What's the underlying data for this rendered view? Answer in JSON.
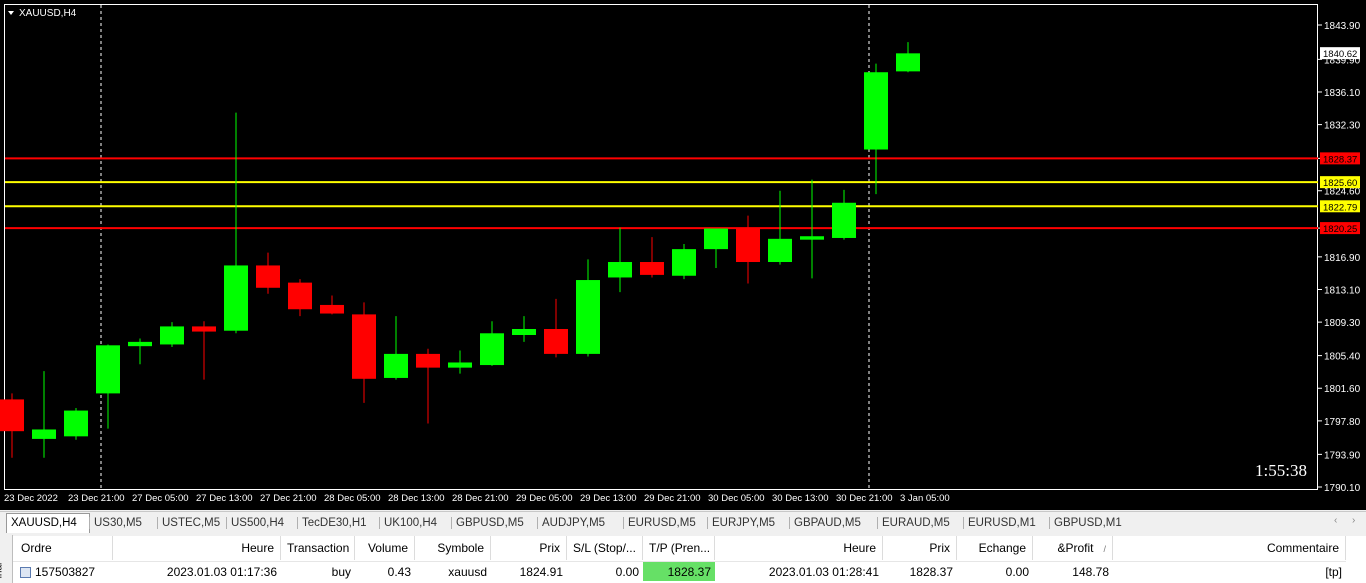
{
  "chart": {
    "symbol_label": "XAUUSD,H4",
    "countdown": "1:55:38",
    "price_axis": [
      "1843.90",
      "1839.90",
      "1836.10",
      "1832.30",
      "1828.37",
      "1824.60",
      "1820.25",
      "1816.90",
      "1813.10",
      "1809.30",
      "1805.40",
      "1801.60",
      "1797.80",
      "1793.90",
      "1790.10"
    ],
    "time_axis": [
      "23 Dec 2022",
      "23 Dec 21:00",
      "27 Dec 05:00",
      "27 Dec 13:00",
      "27 Dec 21:00",
      "28 Dec 05:00",
      "28 Dec 13:00",
      "28 Dec 21:00",
      "29 Dec 05:00",
      "29 Dec 13:00",
      "29 Dec 21:00",
      "30 Dec 05:00",
      "30 Dec 13:00",
      "30 Dec 21:00",
      "3 Jan 05:00"
    ],
    "current_price": "1840.62",
    "levels": [
      {
        "label": "1828.37",
        "price": 1828.37,
        "color": "#ff0000",
        "text_color": "#000000"
      },
      {
        "label": "1825.60",
        "price": 1825.6,
        "color": "#ffff00",
        "text_color": "#000000"
      },
      {
        "label": "1822.79",
        "price": 1822.79,
        "color": "#ffff00",
        "text_color": "#000000"
      },
      {
        "label": "1820.25",
        "price": 1820.25,
        "color": "#ff0000",
        "text_color": "#000000"
      }
    ],
    "colors": {
      "bull": "#00ff00",
      "bear": "#ff0000",
      "background": "#000000",
      "axis_text": "#ffffff"
    }
  },
  "chart_data": {
    "type": "candlestick",
    "title": "XAUUSD,H4",
    "ylim": [
      1790.1,
      1843.9
    ],
    "candles": [
      {
        "o": 1800.3,
        "h": 1801.0,
        "l": 1793.5,
        "c": 1796.6
      },
      {
        "o": 1795.7,
        "h": 1803.6,
        "l": 1793.5,
        "c": 1796.8
      },
      {
        "o": 1796.0,
        "h": 1799.3,
        "l": 1795.6,
        "c": 1799.0
      },
      {
        "o": 1801.0,
        "h": 1806.7,
        "l": 1796.9,
        "c": 1806.6
      },
      {
        "o": 1806.5,
        "h": 1807.4,
        "l": 1804.4,
        "c": 1807.0
      },
      {
        "o": 1806.7,
        "h": 1809.3,
        "l": 1806.4,
        "c": 1808.8
      },
      {
        "o": 1808.8,
        "h": 1809.4,
        "l": 1802.6,
        "c": 1808.2
      },
      {
        "o": 1808.3,
        "h": 1833.7,
        "l": 1808.0,
        "c": 1815.9
      },
      {
        "o": 1815.9,
        "h": 1817.4,
        "l": 1812.6,
        "c": 1813.3
      },
      {
        "o": 1813.9,
        "h": 1814.3,
        "l": 1810.0,
        "c": 1810.8
      },
      {
        "o": 1811.3,
        "h": 1812.4,
        "l": 1810.2,
        "c": 1810.3
      },
      {
        "o": 1810.2,
        "h": 1811.6,
        "l": 1799.9,
        "c": 1802.7
      },
      {
        "o": 1802.8,
        "h": 1810.0,
        "l": 1802.6,
        "c": 1805.6
      },
      {
        "o": 1805.6,
        "h": 1806.2,
        "l": 1797.5,
        "c": 1804.0
      },
      {
        "o": 1804.0,
        "h": 1806.0,
        "l": 1803.3,
        "c": 1804.6
      },
      {
        "o": 1804.3,
        "h": 1809.4,
        "l": 1804.2,
        "c": 1808.0
      },
      {
        "o": 1807.8,
        "h": 1810.0,
        "l": 1807.0,
        "c": 1808.5
      },
      {
        "o": 1808.5,
        "h": 1812.0,
        "l": 1805.2,
        "c": 1805.6
      },
      {
        "o": 1805.6,
        "h": 1816.6,
        "l": 1805.3,
        "c": 1814.2
      },
      {
        "o": 1814.5,
        "h": 1820.3,
        "l": 1812.8,
        "c": 1816.3
      },
      {
        "o": 1816.3,
        "h": 1819.2,
        "l": 1814.5,
        "c": 1814.8
      },
      {
        "o": 1814.7,
        "h": 1818.4,
        "l": 1814.3,
        "c": 1817.8
      },
      {
        "o": 1817.8,
        "h": 1820.2,
        "l": 1815.6,
        "c": 1820.2
      },
      {
        "o": 1820.2,
        "h": 1821.7,
        "l": 1813.8,
        "c": 1816.3
      },
      {
        "o": 1816.3,
        "h": 1824.6,
        "l": 1816.0,
        "c": 1819.0
      },
      {
        "o": 1818.9,
        "h": 1825.9,
        "l": 1814.4,
        "c": 1819.3
      },
      {
        "o": 1819.1,
        "h": 1824.7,
        "l": 1818.9,
        "c": 1823.2
      },
      {
        "o": 1829.4,
        "h": 1839.4,
        "l": 1824.2,
        "c": 1838.4
      },
      {
        "o": 1838.5,
        "h": 1841.9,
        "l": 1838.4,
        "c": 1840.6
      }
    ]
  },
  "tabs": [
    "XAUUSD,H4",
    "US30,M5",
    "USTEC,M5",
    "US500,H4",
    "TecDE30,H1",
    "UK100,H4",
    "GBPUSD,M5",
    "AUDJPY,M5",
    "EURUSD,M5",
    "EURJPY,M5",
    "GBPAUD,M5",
    "EURAUD,M5",
    "EURUSD,M1",
    "GBPUSD,M1"
  ],
  "terminal_label": "inal",
  "table": {
    "headers": [
      "Ordre",
      "Heure",
      "Transaction",
      "Volume",
      "Symbole",
      "Prix",
      "S/L (Stop/...",
      "T/P (Pren...",
      "Heure",
      "Prix",
      "Echange",
      "&Profit",
      "Commentaire"
    ],
    "sort_indicator": "/",
    "row": [
      "157503827",
      "2023.01.03 01:17:36",
      "buy",
      "0.43",
      "xauusd",
      "1824.91",
      "0.00",
      "1828.37",
      "2023.01.03 01:28:41",
      "1828.37",
      "0.00",
      "148.78",
      "[tp]"
    ]
  }
}
